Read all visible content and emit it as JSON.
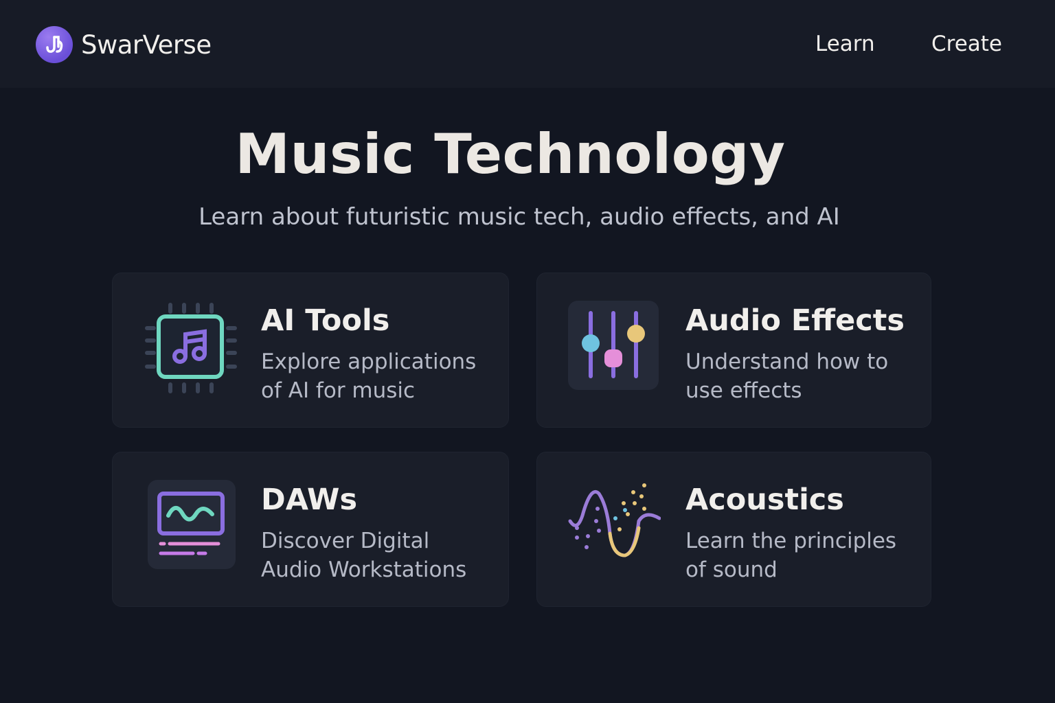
{
  "header": {
    "brand": "SwarVerse",
    "logo_icon": "music-note-logo-icon",
    "nav": [
      {
        "label": "Learn"
      },
      {
        "label": "Create"
      }
    ]
  },
  "hero": {
    "title": "Music Technology",
    "subtitle": "Learn about futuristic music tech, audio effects, and AI"
  },
  "cards": [
    {
      "title": "AI Tools",
      "description": "Explore applications of AI for music",
      "icon": "ai-chip-music-icon"
    },
    {
      "title": "Audio Effects",
      "description": "Understand how to use effects",
      "icon": "mixer-sliders-icon"
    },
    {
      "title": "DAWs",
      "description": "Discover Digital Audio Workstations",
      "icon": "daw-monitor-icon"
    },
    {
      "title": "Acoustics",
      "description": "Learn the principles of sound",
      "icon": "sound-wave-icon"
    }
  ],
  "colors": {
    "background": "#121621",
    "header": "#171b26",
    "card": "#1a1e29",
    "accent_purple": "#8a6ee0",
    "accent_teal": "#6fd7c0",
    "accent_blue": "#6fc3e0",
    "accent_pink": "#e58fd9",
    "accent_yellow": "#e8c77a"
  }
}
